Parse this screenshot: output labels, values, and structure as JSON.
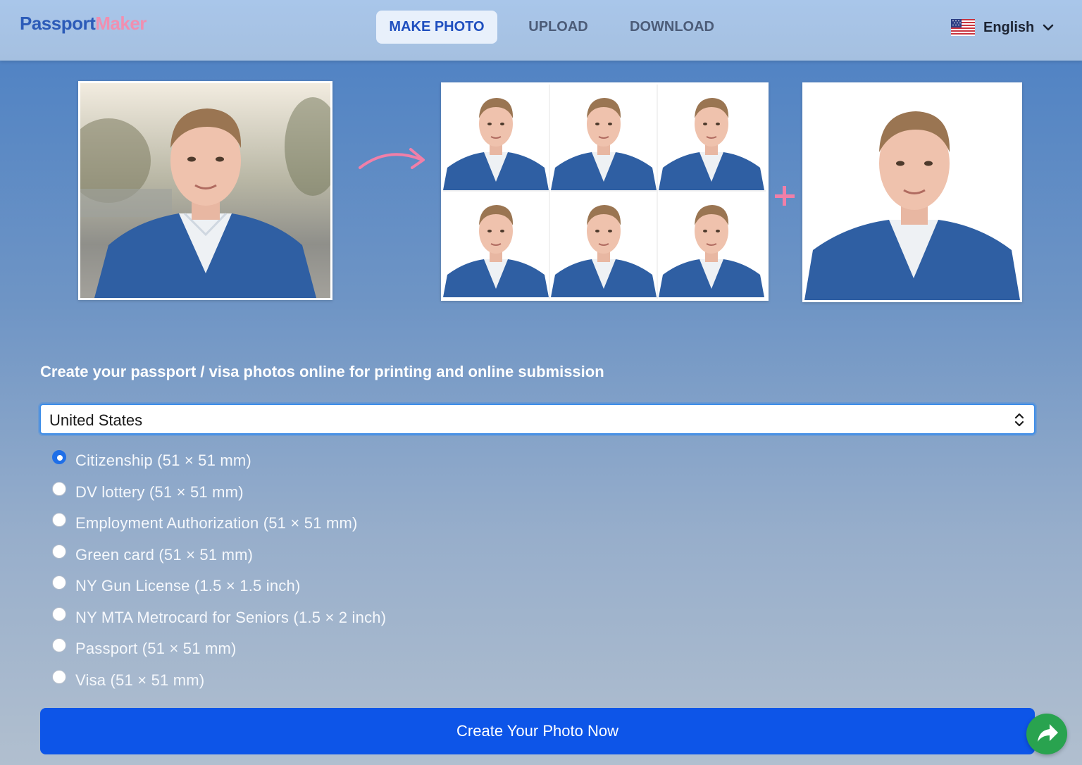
{
  "brand": {
    "part1": "Passport",
    "part2": "Maker",
    "color1": "#2c5bb8",
    "color2": "#f08fb0"
  },
  "nav": {
    "tabs": [
      {
        "label": "MAKE PHOTO",
        "active": true
      },
      {
        "label": "UPLOAD",
        "active": false
      },
      {
        "label": "DOWNLOAD",
        "active": false
      }
    ]
  },
  "language": {
    "label": "English",
    "flag": "us-flag-icon"
  },
  "hero": {
    "arrow_icon": "curved-arrow-icon",
    "plus_icon": "plus-icon",
    "accent": "#f07fa8"
  },
  "tagline": "Create your passport / visa photos online for printing and online submission",
  "country_select": {
    "value": "United States"
  },
  "document_types": [
    {
      "label": "Citizenship (51 × 51 mm)",
      "checked": true
    },
    {
      "label": "DV lottery (51 × 51 mm)",
      "checked": false
    },
    {
      "label": "Employment Authorization (51 × 51 mm)",
      "checked": false
    },
    {
      "label": "Green card (51 × 51 mm)",
      "checked": false
    },
    {
      "label": "NY Gun License (1.5 × 1.5 inch)",
      "checked": false
    },
    {
      "label": "NY MTA Metrocard for Seniors (1.5 × 2 inch)",
      "checked": false
    },
    {
      "label": "Passport (51 × 51 mm)",
      "checked": false
    },
    {
      "label": "Visa (51 × 51 mm)",
      "checked": false
    }
  ],
  "cta": {
    "label": "Create Your Photo Now",
    "color": "#0d55e8"
  },
  "share": {
    "icon": "share-arrow-icon",
    "color": "#29a34f"
  }
}
